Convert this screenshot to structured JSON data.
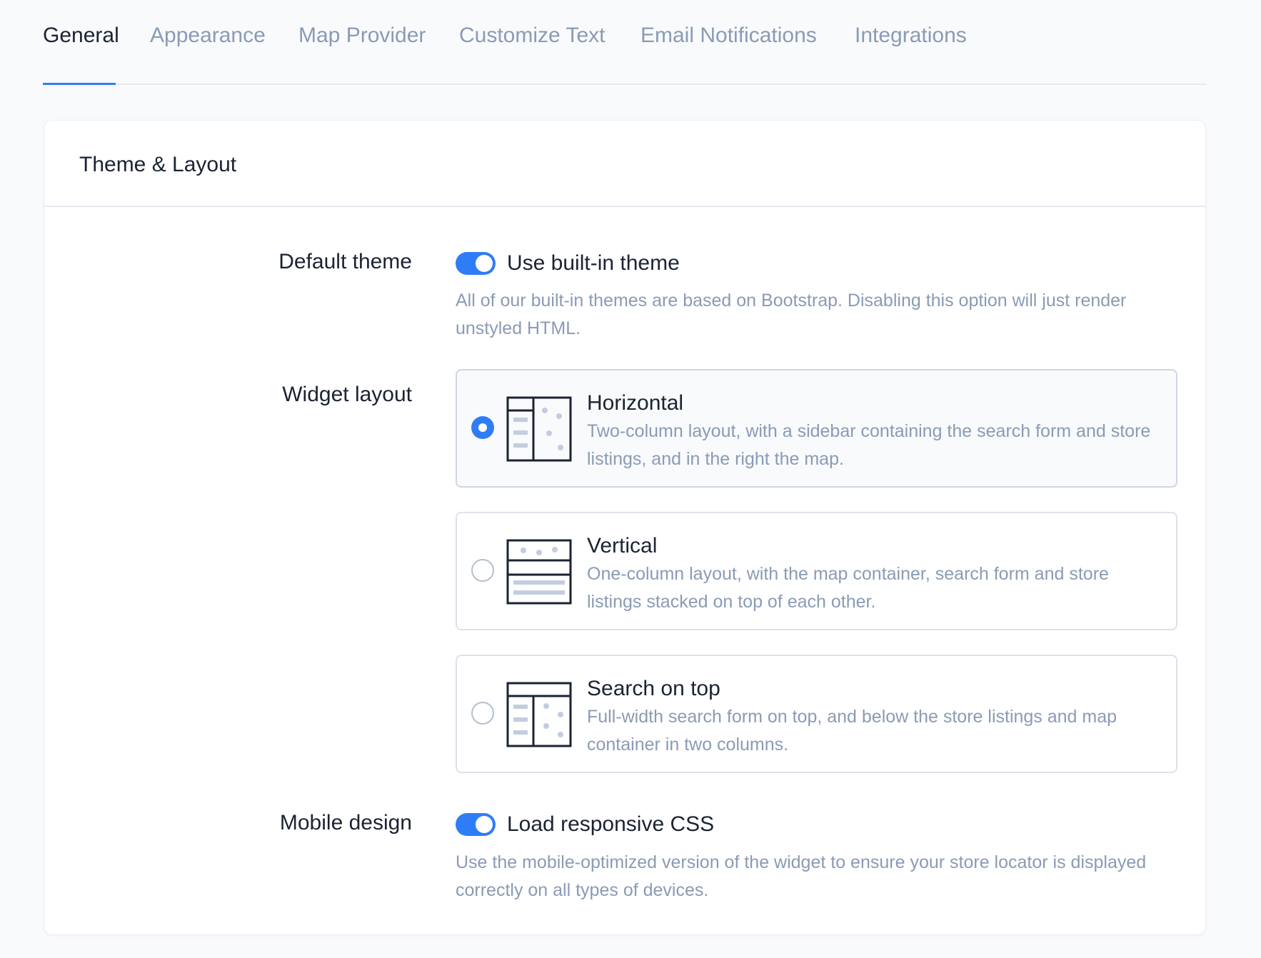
{
  "tabs": [
    {
      "label": "General",
      "active": true
    },
    {
      "label": "Appearance",
      "active": false
    },
    {
      "label": "Map Provider",
      "active": false
    },
    {
      "label": "Customize Text",
      "active": false
    },
    {
      "label": "Email Notifications",
      "active": false
    },
    {
      "label": "Integrations",
      "active": false
    }
  ],
  "section": {
    "title": "Theme & Layout"
  },
  "default_theme": {
    "label": "Default theme",
    "toggle_label": "Use built-in theme",
    "enabled": true,
    "help": "All of our built-in themes are based on Bootstrap. Disabling this option will just render unstyled HTML."
  },
  "widget_layout": {
    "label": "Widget layout",
    "selected": "horizontal",
    "options": [
      {
        "id": "horizontal",
        "title": "Horizontal",
        "description": "Two-column layout, with a sidebar containing the search form and store listings, and in the right the map.",
        "icon": "layout-horizontal-icon",
        "checked": true
      },
      {
        "id": "vertical",
        "title": "Vertical",
        "description": "One-column layout, with the map container, search form and store listings stacked on top of each other.",
        "icon": "layout-vertical-icon",
        "checked": false
      },
      {
        "id": "search-on-top",
        "title": "Search on top",
        "description": "Full-width search form on top, and below the store listings and map container in two columns.",
        "icon": "layout-search-on-top-icon",
        "checked": false
      }
    ]
  },
  "mobile_design": {
    "label": "Mobile design",
    "toggle_label": "Load responsive CSS",
    "enabled": true,
    "help": "Use the mobile-optimized version of the widget to ensure your store locator is displayed correctly on all types of devices."
  },
  "colors": {
    "accent": "#2f7df6",
    "text": "#1b2333",
    "muted": "#8a9bb5",
    "border": "#dde2ea",
    "icon_stroke": "#1b2333",
    "icon_fill": "#c3cde0"
  }
}
